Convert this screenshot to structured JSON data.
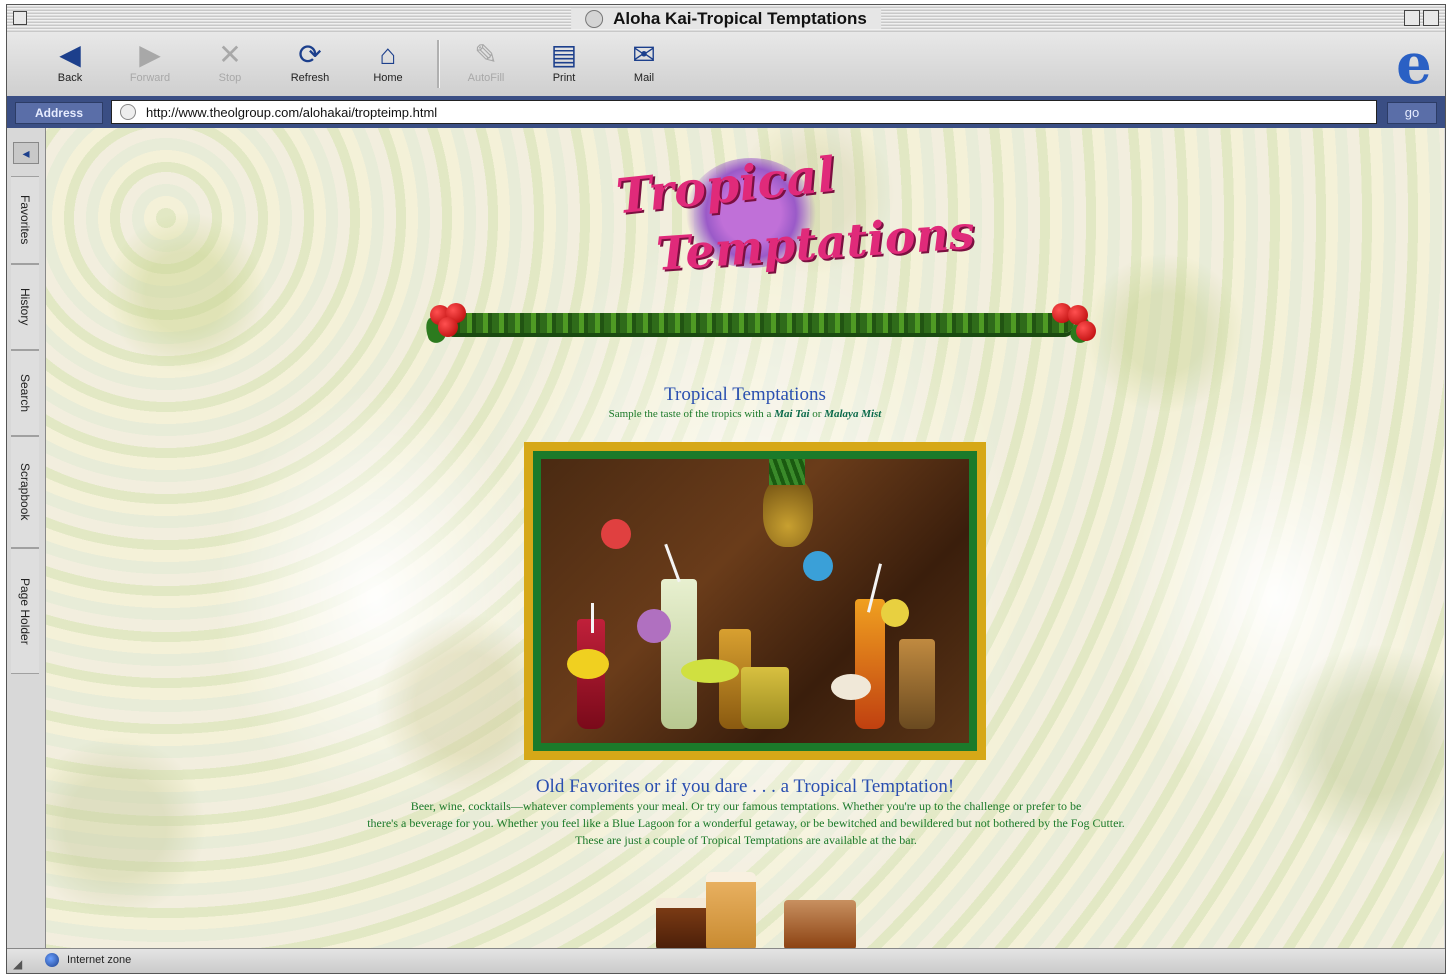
{
  "window": {
    "title": "Aloha Kai-Tropical Temptations"
  },
  "toolbar": {
    "buttons": [
      {
        "label": "Back",
        "icon": "back-arrow-icon",
        "enabled": true,
        "glyph": "◀"
      },
      {
        "label": "Forward",
        "icon": "forward-arrow-icon",
        "enabled": false,
        "glyph": "▶"
      },
      {
        "label": "Stop",
        "icon": "stop-x-icon",
        "enabled": false,
        "glyph": "✕"
      },
      {
        "label": "Refresh",
        "icon": "refresh-icon",
        "enabled": true,
        "glyph": "⟳"
      },
      {
        "label": "Home",
        "icon": "home-icon",
        "enabled": true,
        "glyph": "⌂"
      },
      {
        "label": "AutoFill",
        "icon": "autofill-pen-icon",
        "enabled": false,
        "glyph": "✎"
      },
      {
        "label": "Print",
        "icon": "printer-icon",
        "enabled": true,
        "glyph": "▤"
      },
      {
        "label": "Mail",
        "icon": "mail-icon",
        "enabled": true,
        "glyph": "✉"
      }
    ]
  },
  "address": {
    "label": "Address",
    "url": "http://www.theolgroup.com/alohakai/tropteimp.html",
    "go_label": "go"
  },
  "explorer_bar": {
    "tabs": [
      "Favorites",
      "History",
      "Search",
      "Scrapbook",
      "Page Holder"
    ]
  },
  "page": {
    "logo_line1": "Tropical",
    "logo_line2": "Temptations",
    "heading1": "Tropical Temptations",
    "subline_prefix": "Sample the taste of the tropics with a",
    "subline_drink1": "Mai Tai",
    "subline_connector": "or",
    "subline_drink2": "Malaya Mist",
    "heading2": "Old Favorites or if you dare . . . a Tropical Temptation!",
    "para_line1": "Beer, wine, cocktails—whatever complements your meal. Or try our famous temptations. Whether you're up to the challenge or prefer to be",
    "para_line2": "there's a beverage for you. Whether you feel like a Blue Lagoon for a wonderful getaway, or be bewitched and bewildered but not bothered by the Fog Cutter.",
    "para_line3": "These are just a couple of Tropical Temptations are available at the bar."
  },
  "status": {
    "text": "Internet zone"
  },
  "colors": {
    "logo_pink": "#e02a7a",
    "heading_blue": "#2a4fb0",
    "body_green": "#1c7a2a",
    "frame_gold": "#d6a818",
    "frame_green": "#1b7a2a",
    "address_bar": "#3a4e84"
  }
}
